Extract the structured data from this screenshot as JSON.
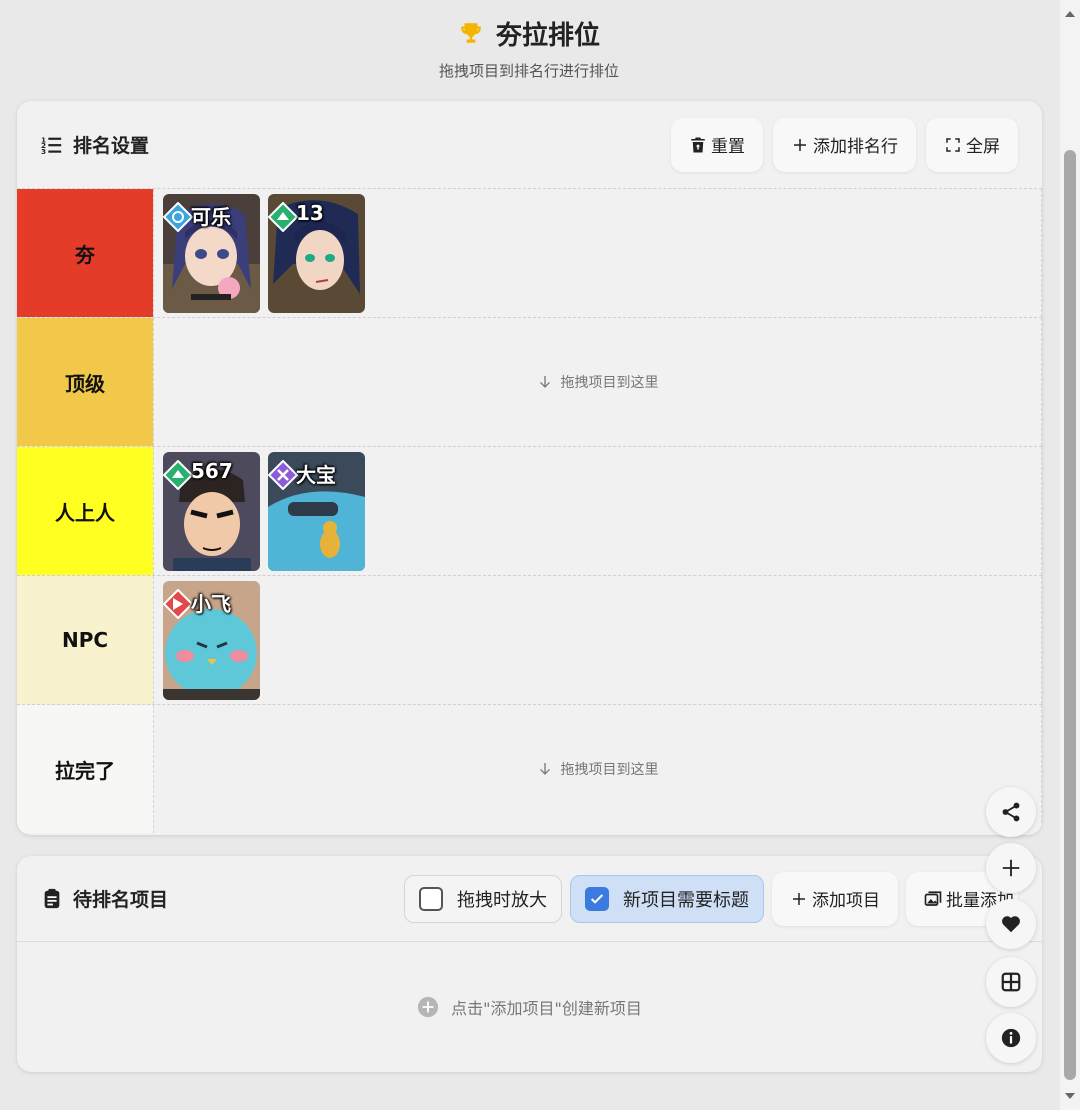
{
  "header": {
    "title": "夯拉排位",
    "subtitle": "拖拽项目到排名行进行排位",
    "icon": "trophy-icon",
    "accent": "#f5b400"
  },
  "rank_card": {
    "title": "排名设置",
    "buttons": {
      "reset": "重置",
      "add_row": "添加排名行",
      "fullscreen": "全屏"
    }
  },
  "tiers": [
    {
      "label": "夯",
      "color": "#e53c2a",
      "items": [
        {
          "name": "可乐",
          "badge_color": "#3aa6e0"
        },
        {
          "name": "13",
          "badge_color": "#28b06e"
        }
      ]
    },
    {
      "label": "顶级",
      "color": "#f2c84b",
      "empty_text": "拖拽项目到这里",
      "items": []
    },
    {
      "label": "人上人",
      "color": "#ffff22",
      "items": [
        {
          "name": "567",
          "badge_color": "#28b06e"
        },
        {
          "name": "大宝",
          "badge_color": "#8d5bd6"
        }
      ]
    },
    {
      "label": "NPC",
      "color": "#f9f2cf",
      "items": [
        {
          "name": "小飞",
          "badge_color": "#e04a4a"
        }
      ]
    },
    {
      "label": "拉完了",
      "color": "#f7f7f5",
      "empty_text": "拖拽项目到这里",
      "items": []
    }
  ],
  "pending_card": {
    "title": "待排名项目",
    "toggle_enlarge": {
      "label": "拖拽时放大",
      "checked": false
    },
    "toggle_title": {
      "label": "新项目需要标题",
      "checked": true
    },
    "add_item": "添加项目",
    "batch_add": "批量添加",
    "empty_text": "点击\"添加项目\"创建新项目"
  },
  "fabs": [
    "share-icon",
    "plus-icon",
    "heart-icon",
    "grid-icon",
    "info-icon"
  ]
}
